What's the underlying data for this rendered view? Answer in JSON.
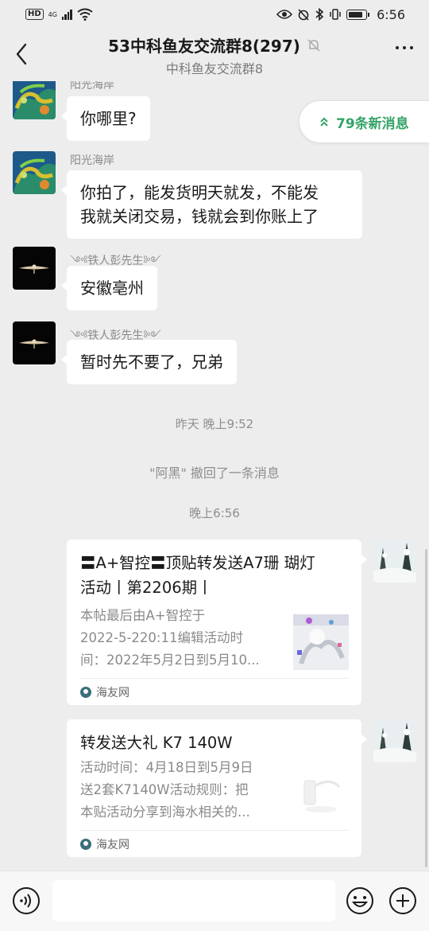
{
  "status_bar": {
    "hd": "HD",
    "network": "4G",
    "time": "6:56"
  },
  "header": {
    "title": "53中科鱼友交流群8(297)",
    "subtitle": "中科鱼友交流群8"
  },
  "new_messages": "79条新消息",
  "messages": [
    {
      "sender": "阳光海岸",
      "text": "你哪里?"
    },
    {
      "sender": "阳光海岸",
      "text_line1": "你拍了，能发货明天就发，不能发",
      "text_line2": "我就关闭交易，钱就会到你账上了"
    },
    {
      "sender": "༺铁人彭先生༻",
      "text": "安徽亳州"
    },
    {
      "sender": "༺铁人彭先生༻",
      "text": "暂时先不要了，兄弟"
    }
  ],
  "system": {
    "time1": "昨天 晚上9:52",
    "recall": "\"阿黑\" 撤回了一条消息",
    "time2": "晚上6:56"
  },
  "cards": [
    {
      "title_line1": "〓A+智控〓顶贴转发送A7珊 瑚灯",
      "title_line2": "活动丨第2206期丨",
      "desc_line1": "本帖最后由A+智控于",
      "desc_line2": "2022-5-220:11编辑活动时",
      "desc_line3": "间：2022年5月2日到5月10...",
      "source": "海友网"
    },
    {
      "title_line1": "转发送大礼 K7 140W",
      "desc_line1": "活动时间：4月18日到5月9日",
      "desc_line2": "送2套K7140W活动规则：把",
      "desc_line3": "本贴活动分享到海水相关的...",
      "source": "海友网"
    }
  ],
  "colors": {
    "background": "#ededed",
    "accent_green": "#35a367",
    "bubble": "#ffffff"
  }
}
